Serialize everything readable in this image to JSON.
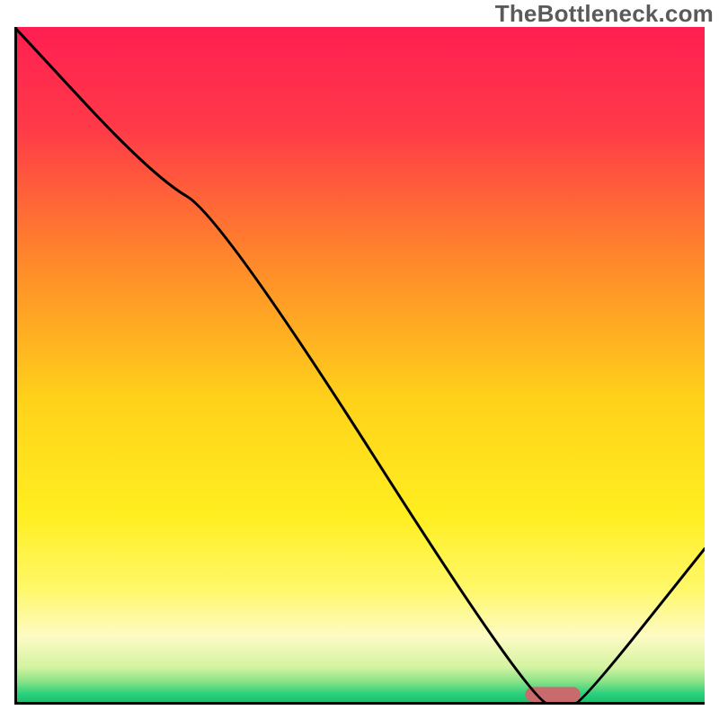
{
  "watermark": "TheBottleneck.com",
  "chart_data": {
    "type": "line",
    "title": "",
    "xlabel": "",
    "ylabel": "",
    "xlim": [
      0,
      100
    ],
    "ylim": [
      0,
      100
    ],
    "series": [
      {
        "name": "bottleneck-curve",
        "color": "#000000",
        "x": [
          0,
          20,
          30,
          75,
          80,
          82,
          100
        ],
        "values": [
          100,
          78,
          72,
          0,
          0,
          0,
          23
        ]
      }
    ],
    "annotations": [
      {
        "name": "optimal-marker",
        "type": "bar",
        "x_center": 78,
        "width": 8,
        "height": 2.2,
        "color": "#c96a6d"
      }
    ],
    "gradient_stops": [
      {
        "pos": 0.0,
        "color": "#ff1f52"
      },
      {
        "pos": 0.15,
        "color": "#ff3a48"
      },
      {
        "pos": 0.35,
        "color": "#ff8a2a"
      },
      {
        "pos": 0.55,
        "color": "#ffd21a"
      },
      {
        "pos": 0.72,
        "color": "#ffee20"
      },
      {
        "pos": 0.83,
        "color": "#fff86a"
      },
      {
        "pos": 0.9,
        "color": "#fdfbc4"
      },
      {
        "pos": 0.945,
        "color": "#d3f3a0"
      },
      {
        "pos": 0.965,
        "color": "#8de389"
      },
      {
        "pos": 0.985,
        "color": "#26d07c"
      },
      {
        "pos": 1.0,
        "color": "#1fb66b"
      }
    ],
    "axis": {
      "color": "#000000",
      "width": 4
    }
  }
}
